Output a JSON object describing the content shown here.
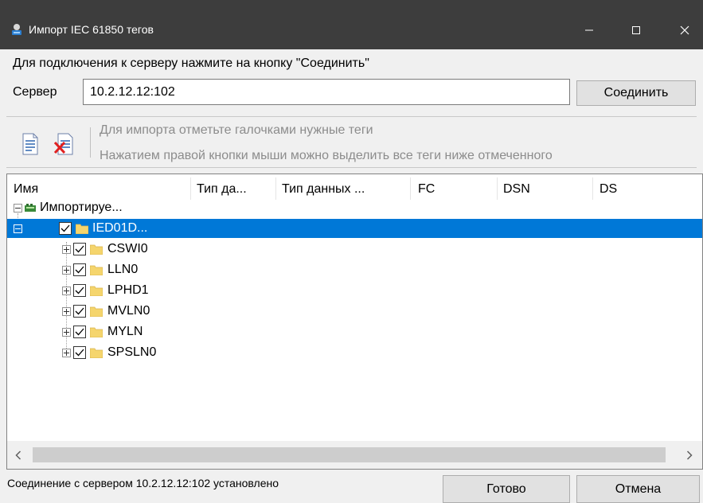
{
  "window": {
    "title": "Импорт IEC 61850 тегов",
    "icon": "app-icon",
    "controls": [
      "minimize-icon",
      "maximize-icon",
      "close-icon"
    ]
  },
  "connection": {
    "instruction": "Для подключения к серверу нажмите на кнопку \"Соединить\"",
    "server_label": "Сервер",
    "server_value": "10.2.12.12:102",
    "connect_label": "Соединить"
  },
  "toolbar": {
    "icons": [
      "select-all-icon",
      "deselect-all-icon"
    ],
    "hint_1": "Для импорта отметьте галочками нужные теги",
    "hint_2": "Нажатием правой кнопки мыши можно выделить все теги ниже отмеченного"
  },
  "tree": {
    "columns": [
      "Имя",
      "Тип да...",
      "Тип данных ...",
      "FC",
      "DSN",
      "DS"
    ],
    "root": {
      "label": "Импортируе...",
      "icon": "device-icon"
    },
    "ied": {
      "label": "IED01D...",
      "checked": true,
      "selected": true
    },
    "nodes": [
      {
        "label": "CSWI0",
        "checked": true
      },
      {
        "label": "LLN0",
        "checked": true
      },
      {
        "label": "LPHD1",
        "checked": true
      },
      {
        "label": "MVLN0",
        "checked": true
      },
      {
        "label": "MYLN",
        "checked": true
      },
      {
        "label": "SPSLN0",
        "checked": true
      }
    ]
  },
  "status": "Соединение с сервером 10.2.12.12:102 установлено",
  "buttons": {
    "ok": "Готово",
    "cancel": "Отмена"
  },
  "colors": {
    "titlebar": "#3d3d3d",
    "selection": "#0078d7",
    "folder": "#f5d56d",
    "hint_text": "#8c8c8c"
  }
}
